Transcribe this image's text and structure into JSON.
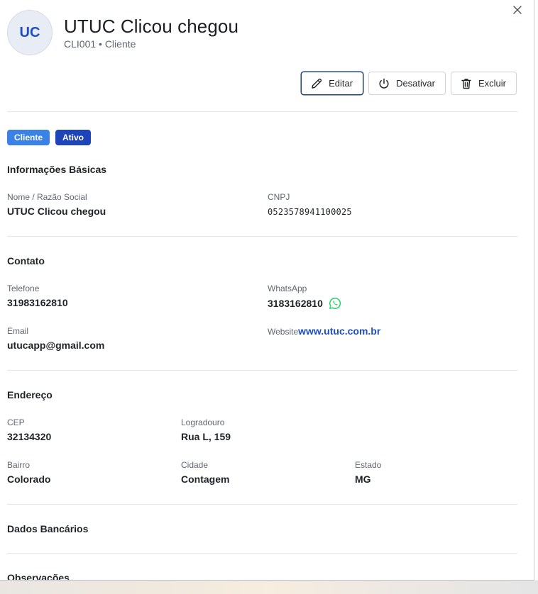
{
  "header": {
    "avatar_initials": "UC",
    "title": "UTUC Clicou chegou",
    "subtitle": "CLI001 • Cliente",
    "close_icon": "close-icon"
  },
  "actions": {
    "edit": {
      "label": "Editar",
      "icon": "pencil-icon"
    },
    "deactivate": {
      "label": "Desativar",
      "icon": "power-icon"
    },
    "delete": {
      "label": "Excluir",
      "icon": "trash-icon"
    }
  },
  "badges": [
    {
      "label": "Cliente",
      "color": "#3b82e6"
    },
    {
      "label": "Ativo",
      "color": "#1d44b8"
    }
  ],
  "basic": {
    "title": "Informações Básicas",
    "name_label": "Nome / Razão Social",
    "name_value": "UTUC Clicou chegou",
    "cnpj_label": "CNPJ",
    "cnpj_value": "0523578941100025"
  },
  "contact": {
    "title": "Contato",
    "phone_label": "Telefone",
    "phone_value": "31983162810",
    "whatsapp_label": "WhatsApp",
    "whatsapp_value": "3183162810",
    "whatsapp_icon": "whatsapp-icon",
    "email_label": "Email",
    "email_value": "utucapp@gmail.com",
    "website_label": "Website",
    "website_value": "www.utuc.com.br"
  },
  "address": {
    "title": "Endereço",
    "cep_label": "CEP",
    "cep_value": "32134320",
    "street_label": "Logradouro",
    "street_value": "Rua L, 159",
    "district_label": "Bairro",
    "district_value": "Colorado",
    "city_label": "Cidade",
    "city_value": "Contagem",
    "state_label": "Estado",
    "state_value": "MG"
  },
  "bank": {
    "title": "Dados Bancários"
  },
  "notes": {
    "title": "Observações"
  },
  "colors": {
    "accent": "#1d4ec2",
    "whatsapp": "#25d366"
  }
}
